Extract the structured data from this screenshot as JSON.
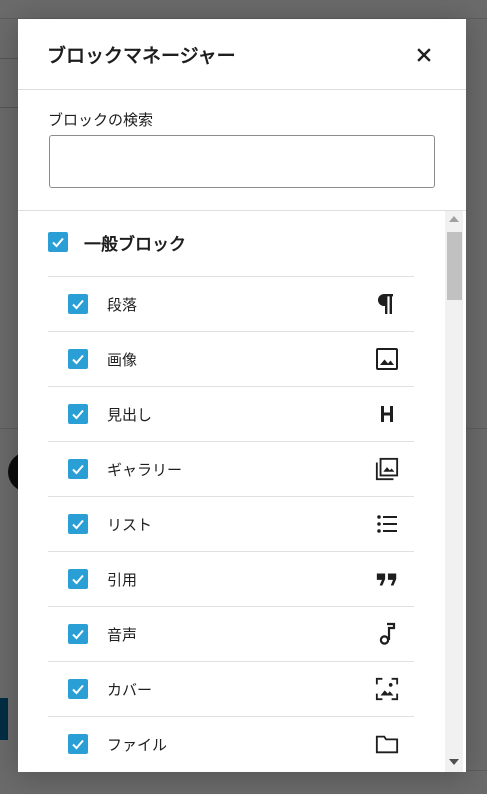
{
  "modal": {
    "title": "ブロックマネージャー",
    "close_icon": "close-icon",
    "search": {
      "label": "ブロックの検索",
      "value": "",
      "placeholder": ""
    },
    "category": {
      "label": "一般ブロック",
      "checked": true
    },
    "blocks": [
      {
        "label": "段落",
        "icon": "paragraph-icon",
        "checked": true
      },
      {
        "label": "画像",
        "icon": "image-icon",
        "checked": true
      },
      {
        "label": "見出し",
        "icon": "heading-icon",
        "checked": true
      },
      {
        "label": "ギャラリー",
        "icon": "gallery-icon",
        "checked": true
      },
      {
        "label": "リスト",
        "icon": "list-icon",
        "checked": true
      },
      {
        "label": "引用",
        "icon": "quote-icon",
        "checked": true
      },
      {
        "label": "音声",
        "icon": "audio-icon",
        "checked": true
      },
      {
        "label": "カバー",
        "icon": "cover-icon",
        "checked": true
      },
      {
        "label": "ファイル",
        "icon": "file-icon",
        "checked": true
      }
    ]
  },
  "colors": {
    "checkbox": "#2a9fd6",
    "text": "#1e1e1e",
    "icon": "#1e1e1e",
    "overlay": "rgba(0,0,0,0.58)"
  }
}
